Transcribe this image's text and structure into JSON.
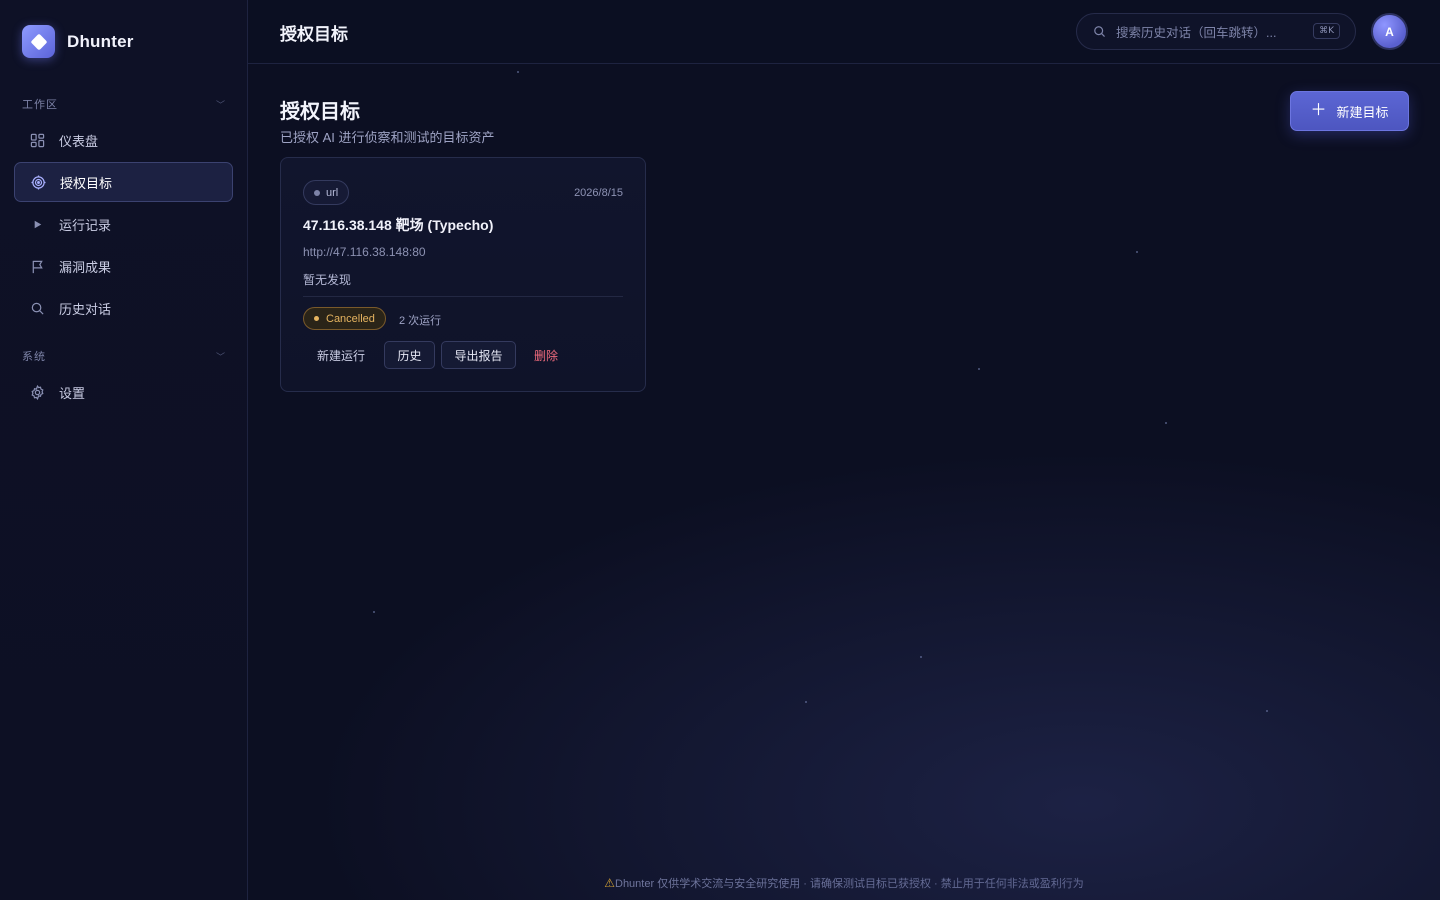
{
  "brand": {
    "name": "Dhunter"
  },
  "sidebar": {
    "sections": [
      {
        "label": "工作区"
      },
      {
        "label": "系统"
      }
    ],
    "items": [
      {
        "label": "仪表盘",
        "icon": "dashboard-icon"
      },
      {
        "label": "授权目标",
        "icon": "target-icon",
        "active": true
      },
      {
        "label": "运行记录",
        "icon": "play-icon"
      },
      {
        "label": "漏洞成果",
        "icon": "flag-icon"
      },
      {
        "label": "历史对话",
        "icon": "search-icon"
      },
      {
        "label": "设置",
        "icon": "gear-icon"
      }
    ]
  },
  "header": {
    "title": "授权目标",
    "search_placeholder": "搜索历史对话（回车跳转）...",
    "shortcut": "⌘K",
    "avatar_initial": "A"
  },
  "page": {
    "title": "授权目标",
    "subtitle": "已授权 AI 进行侦察和测试的目标资产",
    "new_target_label": "新建目标"
  },
  "targets": [
    {
      "type": "url",
      "date": "2026/8/15",
      "name": "47.116.38.148 靶场 (Typecho)",
      "url": "http://47.116.38.148:80",
      "findings": "暂无发现",
      "status": "Cancelled",
      "run_count": "2 次运行",
      "actions": {
        "new_run": "新建运行",
        "history": "历史",
        "export": "导出报告",
        "delete": "删除"
      }
    }
  ],
  "footer": {
    "note": "Dhunter 仅供学术交流与安全研究使用 · 请确保测试目标已获授权 · 禁止用于任何非法或盈利行为"
  },
  "colors": {
    "background": "#0c0f22",
    "accent": "#5c66d4",
    "status_cancelled": "#e6b460",
    "danger": "#ef6b7d"
  }
}
